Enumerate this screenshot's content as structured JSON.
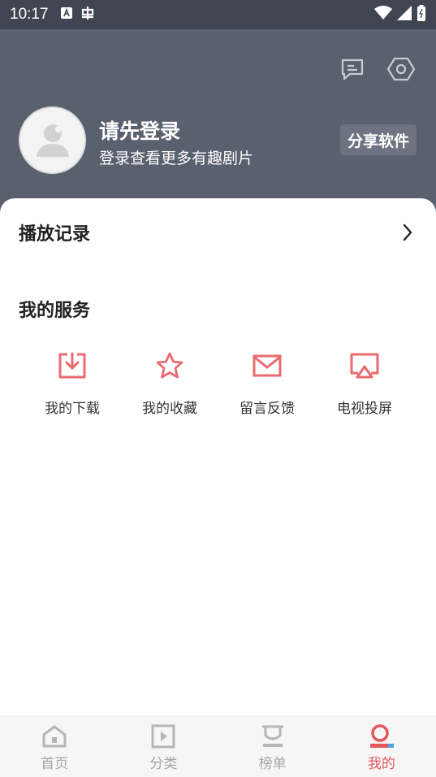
{
  "status_bar": {
    "time": "10:17"
  },
  "header": {
    "login_title": "请先登录",
    "login_subtitle": "登录查看更多有趣剧片",
    "share_button": "分享软件"
  },
  "history": {
    "label": "播放记录"
  },
  "services": {
    "title": "我的服务",
    "items": [
      {
        "label": "我的下载",
        "icon": "download-icon"
      },
      {
        "label": "我的收藏",
        "icon": "star-icon"
      },
      {
        "label": "留言反馈",
        "icon": "mail-icon"
      },
      {
        "label": "电视投屏",
        "icon": "cast-icon"
      }
    ]
  },
  "tabbar": {
    "tabs": [
      {
        "label": "首页",
        "icon": "home-icon",
        "active": false
      },
      {
        "label": "分类",
        "icon": "category-icon",
        "active": false
      },
      {
        "label": "榜单",
        "icon": "ranking-icon",
        "active": false
      },
      {
        "label": "我的",
        "icon": "profile-icon",
        "active": true
      }
    ]
  },
  "colors": {
    "accent": "#e5575d",
    "header_bg": "#59606e",
    "status_bg": "#3f4652"
  }
}
